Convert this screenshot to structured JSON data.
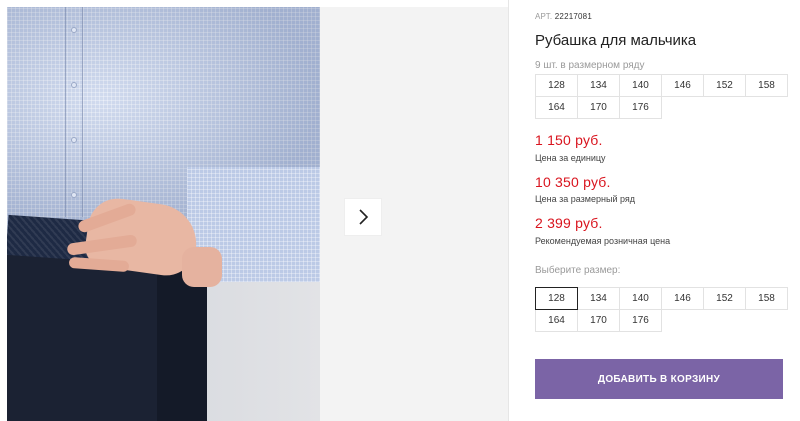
{
  "product": {
    "article_label": "АРТ.",
    "article_number": "22217081",
    "title": "Рубашка для мальчика",
    "row_count_text": "9 шт. в размерном ряду"
  },
  "size_row": [
    "128",
    "134",
    "140",
    "146",
    "152",
    "158",
    "164",
    "170",
    "176"
  ],
  "prices": {
    "unit_price": "1 150 руб.",
    "unit_label": "Цена за единицу",
    "row_price": "10 350 руб.",
    "row_label": "Цена за размерный ряд",
    "retail_price": "2 399 руб.",
    "retail_label": "Рекомендуемая розничная цена"
  },
  "size_select": {
    "label": "Выберите размер:",
    "options": [
      "128",
      "134",
      "140",
      "146",
      "152",
      "158",
      "164",
      "170",
      "176"
    ],
    "selected": "128"
  },
  "cart_button_label": "ДОБАВИТЬ В КОРЗИНУ",
  "gallery": {
    "image_description_icon": "product-photo",
    "next_icon": "chevron-right-icon"
  },
  "colors": {
    "price_red": "#d9141e",
    "button_purple": "#7b64a6"
  }
}
